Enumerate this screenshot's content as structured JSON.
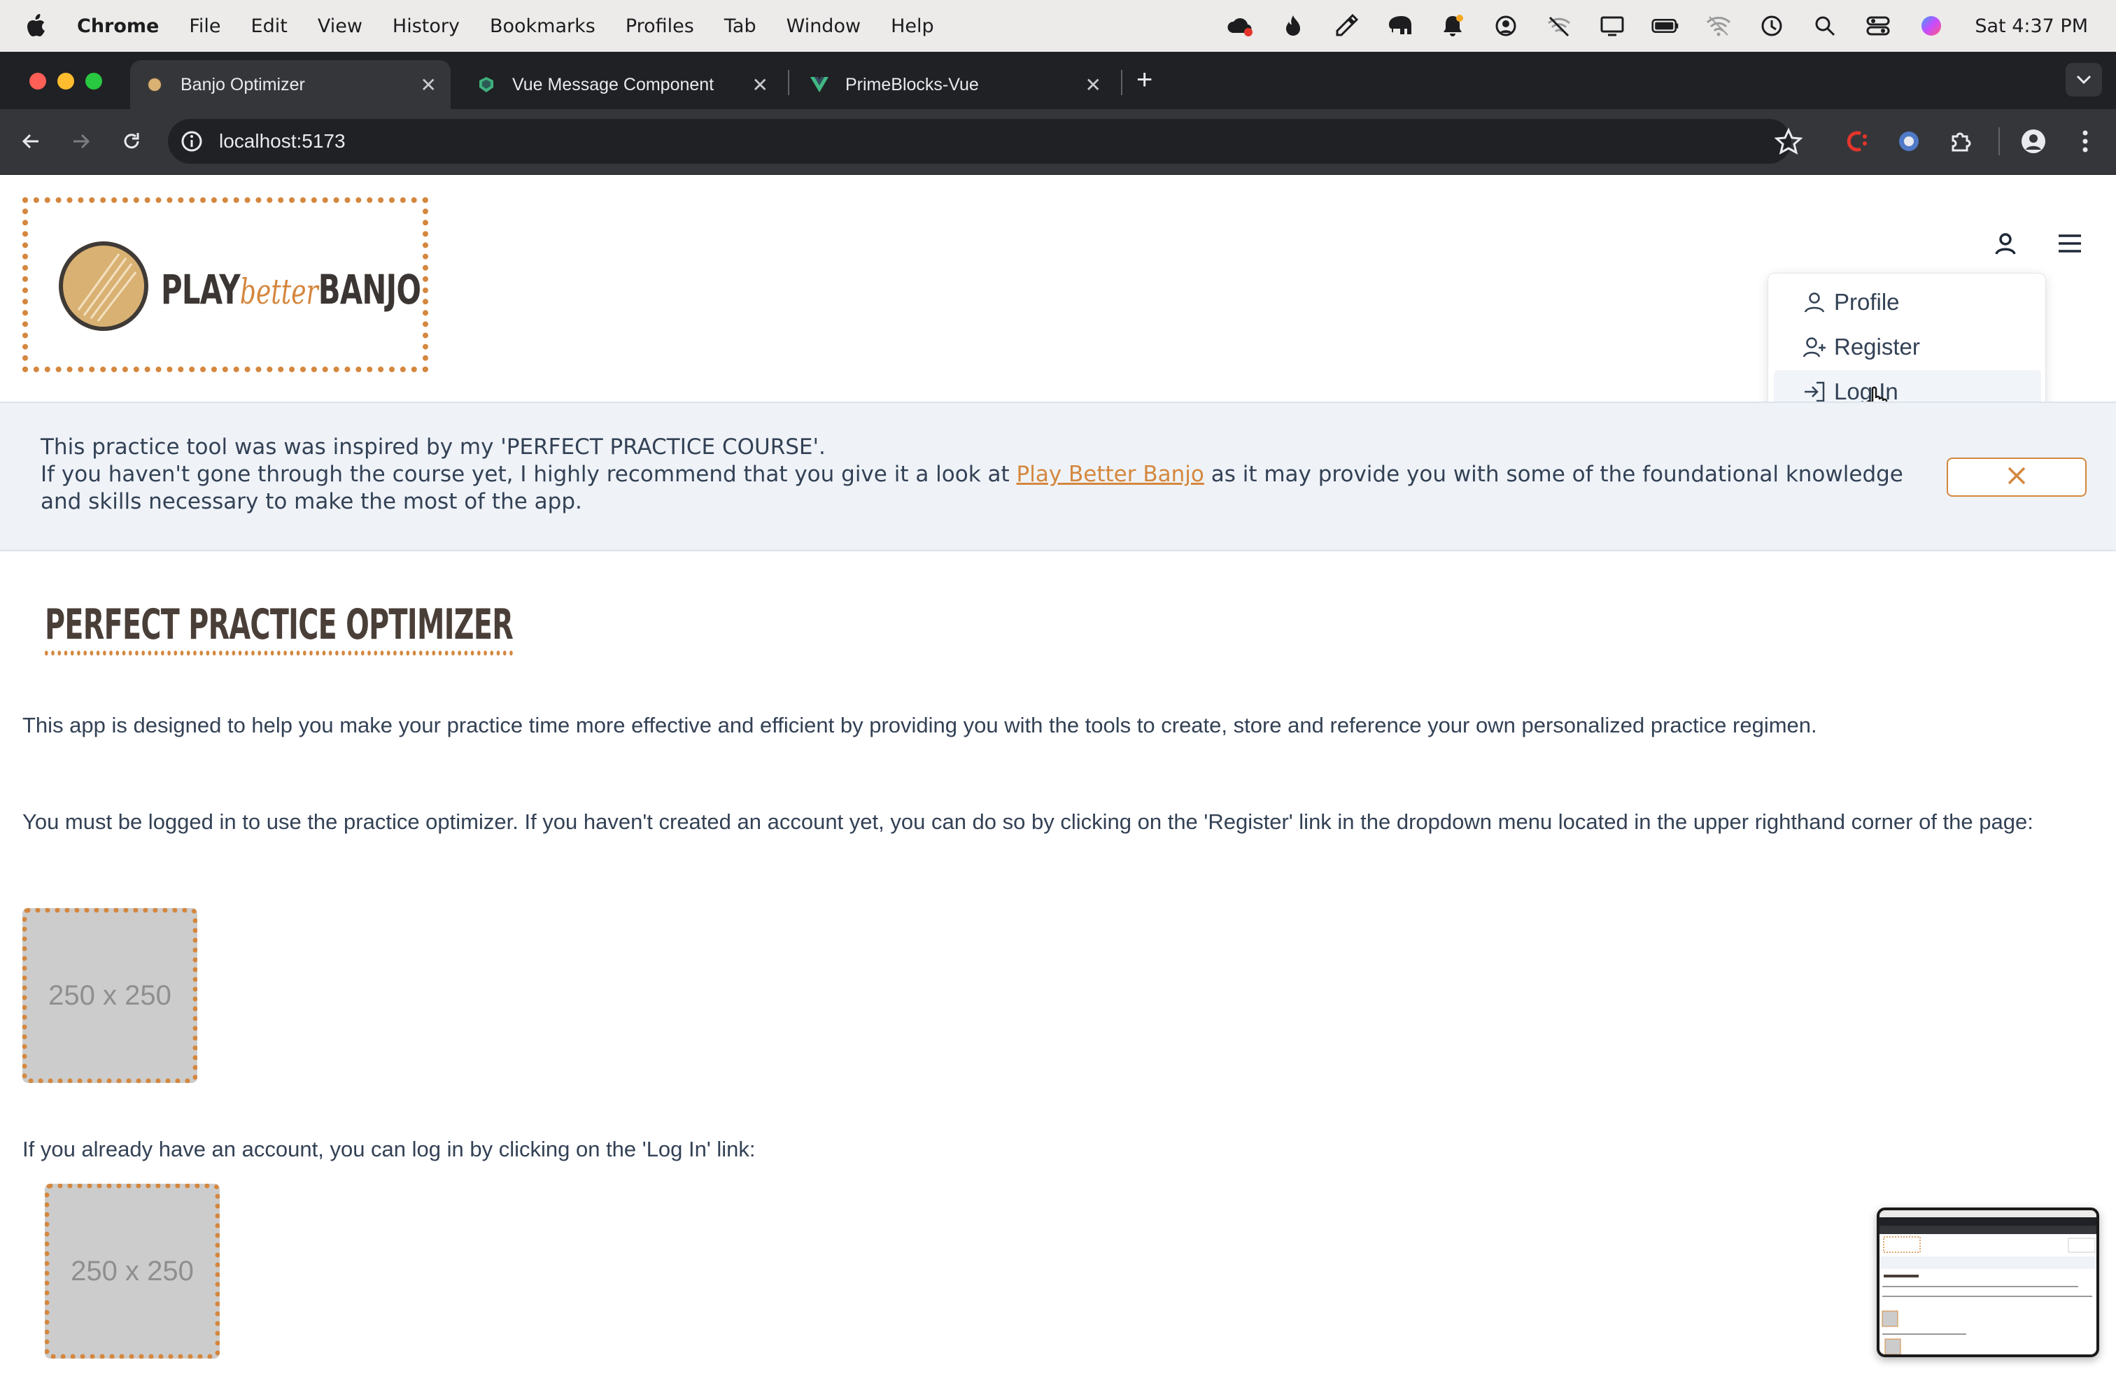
{
  "menubar": {
    "app_name": "Chrome",
    "items": [
      "File",
      "Edit",
      "View",
      "History",
      "Bookmarks",
      "Profiles",
      "Tab",
      "Window",
      "Help"
    ],
    "clock": "Sat 4:37 PM"
  },
  "tabs": [
    {
      "title": "Banjo Optimizer",
      "close": "✕"
    },
    {
      "title": "Vue Message Component",
      "close": "✕"
    },
    {
      "title": "PrimeBlocks-Vue",
      "close": "✕"
    }
  ],
  "newtab": "+",
  "address_bar": {
    "url": "localhost:5173"
  },
  "logo": {
    "play": "PLAY",
    "better": "better",
    "banjo": "BANJO"
  },
  "user_menu": {
    "items": [
      {
        "label": "Profile"
      },
      {
        "label": "Register"
      },
      {
        "label": "Log In"
      }
    ]
  },
  "banner": {
    "line1": "This practice tool was was inspired by my 'PERFECT PRACTICE COURSE'.",
    "line2_before": "If you haven't gone through the course yet, I highly recommend that you give it a look at ",
    "link": "Play Better Banjo",
    "line2_after": " as it may provide you with some of the foundational knowledge and skills necessary to make the most of the app."
  },
  "main": {
    "heading": "PERFECT PRACTICE OPTIMIZER",
    "intro": "This app is designed to help you make your practice time more effective and efficient by providing you with the tools to create, store and reference your own personalized practice regimen.",
    "login_notice": "You must be logged in to use the practice optimizer. If you haven't created an account yet, you can do so by clicking on the 'Register' link in the dropdown menu located in the upper righthand corner of the page:",
    "placeholder1": "250 x 250",
    "login_hint": "If you already have an account, you can log in by clicking on the 'Log In' link:",
    "placeholder2": "250 x 250"
  },
  "colors": {
    "accent": "#d4873e",
    "banner_bg": "#eff3f8",
    "text": "#334155"
  }
}
